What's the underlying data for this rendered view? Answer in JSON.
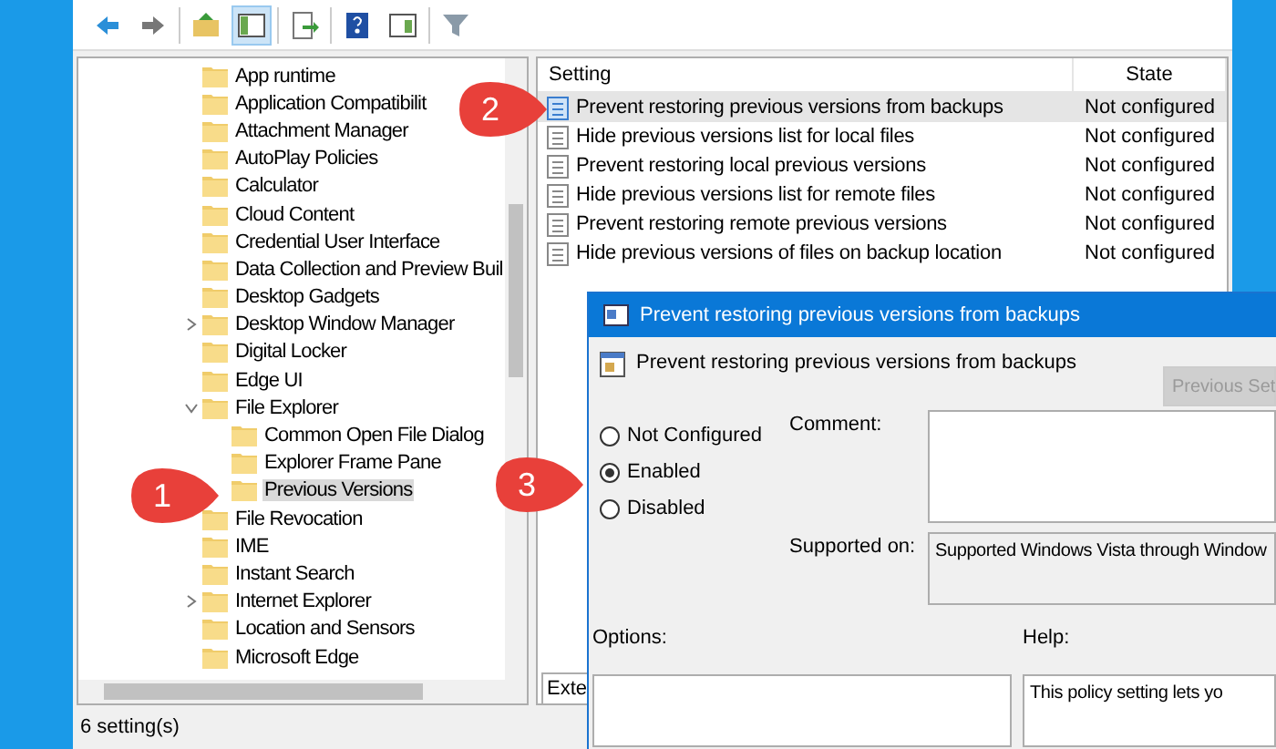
{
  "toolbar": {
    "buttons": [
      {
        "kind": "back",
        "pressed": false
      },
      {
        "kind": "forward",
        "pressed": false
      },
      {
        "kind": "up",
        "pressed": false
      },
      {
        "kind": "tree",
        "pressed": true
      },
      {
        "kind": "export",
        "pressed": false
      },
      {
        "kind": "help",
        "pressed": false
      },
      {
        "kind": "view",
        "pressed": false
      },
      {
        "kind": "filter",
        "pressed": false
      }
    ]
  },
  "tree": {
    "items": [
      {
        "label": "App runtime",
        "selected": false
      },
      {
        "label": "Application Compatibilit",
        "selected": false
      },
      {
        "label": "Attachment Manager",
        "selected": false
      },
      {
        "label": "AutoPlay Policies",
        "selected": false
      },
      {
        "label": "Calculator",
        "selected": false
      },
      {
        "label": "Cloud Content",
        "selected": false
      },
      {
        "label": "Credential User Interface",
        "selected": false
      },
      {
        "label": "Data Collection and Preview Buil",
        "selected": false
      },
      {
        "label": "Desktop Gadgets",
        "selected": false
      },
      {
        "label": "Desktop Window Manager",
        "selected": false,
        "expanded": false
      },
      {
        "label": "Digital Locker",
        "selected": false
      },
      {
        "label": "Edge UI",
        "selected": false
      },
      {
        "label": "File Explorer",
        "selected": false,
        "expanded": true,
        "children": [
          {
            "label": "Common Open File Dialog",
            "selected": false
          },
          {
            "label": "Explorer Frame Pane",
            "selected": false
          },
          {
            "label": "Previous Versions",
            "selected": true
          }
        ]
      },
      {
        "label": "File Revocation",
        "selected": false
      },
      {
        "label": "IME",
        "selected": false
      },
      {
        "label": "Instant Search",
        "selected": false
      },
      {
        "label": "Internet Explorer",
        "selected": false,
        "expanded": false
      },
      {
        "label": "Location and Sensors",
        "selected": false
      },
      {
        "label": "Microsoft Edge",
        "selected": false
      }
    ]
  },
  "settings_table": {
    "columns": [
      "Setting",
      "State"
    ],
    "rows": [
      {
        "setting": "Prevent restoring previous versions from backups",
        "state": "Not configured",
        "selected": true
      },
      {
        "setting": "Hide previous versions list for local files",
        "state": "Not configured",
        "selected": false
      },
      {
        "setting": "Prevent restoring local previous versions",
        "state": "Not configured",
        "selected": false
      },
      {
        "setting": "Hide previous versions list for remote files",
        "state": "Not configured",
        "selected": false
      },
      {
        "setting": "Prevent restoring remote previous versions",
        "state": "Not configured",
        "selected": false
      },
      {
        "setting": "Hide previous versions of files on backup location",
        "state": "Not configured",
        "selected": false
      }
    ],
    "tabs": [
      {
        "label": "Exte",
        "selected": true
      }
    ]
  },
  "status_bar": "6 setting(s)",
  "dialog": {
    "title": "Prevent restoring previous versions from backups",
    "heading": "Prevent restoring previous versions from backups",
    "previous_button": {
      "label": "Previous Set",
      "disabled": true
    },
    "options": [
      {
        "label": "Not Configured",
        "selected": false
      },
      {
        "label": "Enabled",
        "selected": true
      },
      {
        "label": "Disabled",
        "selected": false
      }
    ],
    "comment_label": "Comment:",
    "supported_label": "Supported on:",
    "supported_text": "Supported Windows Vista through Window",
    "options_label": "Options:",
    "help_label": "Help:",
    "help_text": "This policy setting lets yo"
  },
  "callouts": [
    {
      "number": "2"
    },
    {
      "number": "1"
    },
    {
      "number": "3"
    }
  ]
}
